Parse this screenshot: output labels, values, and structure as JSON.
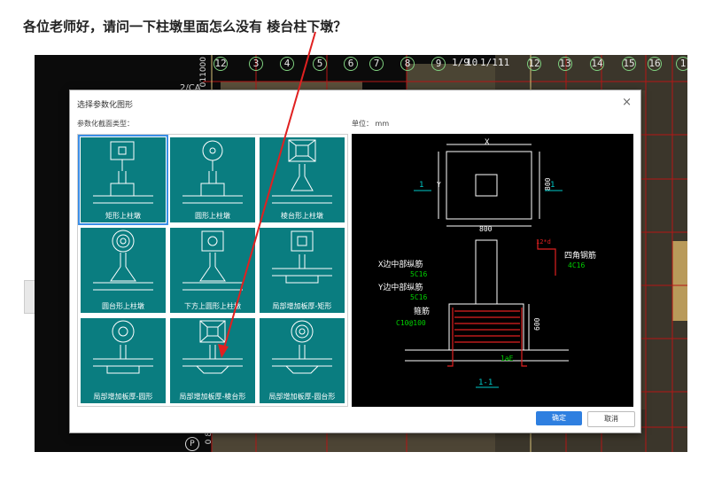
{
  "question": "各位老师好，请问一下柱墩里面怎么没有 棱台柱下墩？",
  "cad": {
    "axis_numbers": [
      "12",
      "3",
      "4",
      "5",
      "6",
      "7",
      "8",
      "9",
      "1/9",
      "10",
      "1/11",
      "11",
      "12",
      "13",
      "14",
      "15",
      "16",
      "1"
    ],
    "side_text_1": "2/CA",
    "side_text_2": "011000",
    "marker_p": "P",
    "bottom_text": "0 8"
  },
  "dialog": {
    "title": "选择参数化图形",
    "close_symbol": "×",
    "section_label": "参数化截面类型：",
    "unit_label": "单位：  mm",
    "items": [
      {
        "label": "矩形上柱墩"
      },
      {
        "label": "圆形上柱墩"
      },
      {
        "label": "棱台形上柱墩"
      },
      {
        "label": "圆台形上柱墩"
      },
      {
        "label": "下方上圆形上柱墩"
      },
      {
        "label": "局部增加板厚-矩形"
      },
      {
        "label": "局部增加板厚-圆形"
      },
      {
        "label": "局部增加板厚-棱台形"
      },
      {
        "label": "局部增加板厚-圆台形"
      }
    ],
    "selected_index": 0,
    "ok_label": "确定",
    "cancel_label": "取消"
  },
  "preview": {
    "x_label": "X",
    "y_label": "Y",
    "dim_800_right": "800",
    "dim_800_bottom": "800",
    "section_mark": "1",
    "labels": {
      "x_rebar": "X边中部纵筋",
      "x_rebar_val": "5C16",
      "y_rebar": "Y边中部纵筋",
      "y_rebar_val": "5C16",
      "stirrup": "箍筋",
      "stirrup_val": "C10@100",
      "corner": "四角钢筋",
      "corner_val": "4C16",
      "height": "600",
      "anchor": "12*d",
      "lae": "1aE",
      "section_title": "1-1"
    }
  },
  "colors": {
    "tile": "#0a7d80",
    "selection": "#3a8ee6",
    "ok_button": "#2e7fe0",
    "annotation_arrow": "#e02020"
  }
}
